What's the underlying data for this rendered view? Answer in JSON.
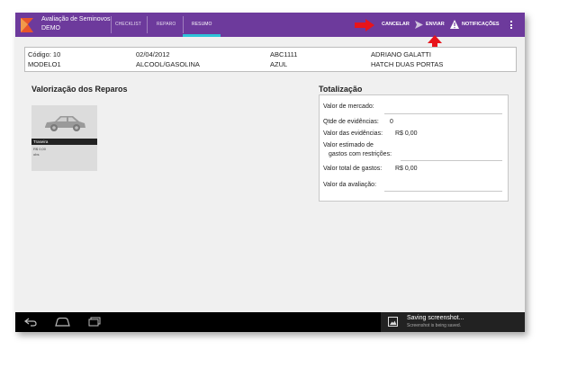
{
  "app": {
    "title": "Avaliação de Seminovos",
    "subtitle": "DEMO"
  },
  "tabs": [
    {
      "label": "CHECKLIST"
    },
    {
      "label": "REPARO"
    },
    {
      "label": "RESUMO",
      "active": true
    }
  ],
  "actions": {
    "cancel": "CANCELAR",
    "send": "ENVIAR",
    "notifications": "NOTIFICAÇÕES"
  },
  "vehicle": {
    "code": "Código: 10",
    "date": "02/04/2012",
    "plate": "ABC1111",
    "owner": "ADRIANO GALATTI",
    "model": "MODELO1",
    "fuel": "ALCOOL/GASOLINA",
    "color": "AZUL",
    "body": "HATCH DUAS PORTAS"
  },
  "repairs": {
    "heading": "Valorização dos Reparos",
    "items": [
      {
        "label": "Traseira",
        "value": "R$ 0,00",
        "note": "obs"
      }
    ]
  },
  "totals": {
    "heading": "Totalização",
    "market_label": "Valor de mercado:",
    "evid_count_label": "Qtde de evidências:",
    "evid_count": "0",
    "evid_value_label": "Valor das evidências:",
    "evid_value": "R$ 0,00",
    "est_label_1": "Valor estimado de",
    "est_label_2": "gastos com restrições:",
    "total_label": "Valor total de gastos:",
    "total_value": "R$ 0,00",
    "eval_label": "Valor da avaliação:"
  },
  "notification": {
    "title": "Saving screenshot...",
    "subtitle": "Screenshot is being saved."
  },
  "colors": {
    "topbar": "#6d3a9c",
    "tab_indicator": "#2ec4d8",
    "logo": "#e8552b",
    "arrow": "#e8141b"
  },
  "icons": {
    "logo": "logo-icon",
    "send": "send-icon",
    "notifications": "warning-icon",
    "menu": "overflow-menu-icon",
    "back": "back-icon",
    "home": "home-icon",
    "recents": "recents-icon",
    "image": "image-icon"
  }
}
